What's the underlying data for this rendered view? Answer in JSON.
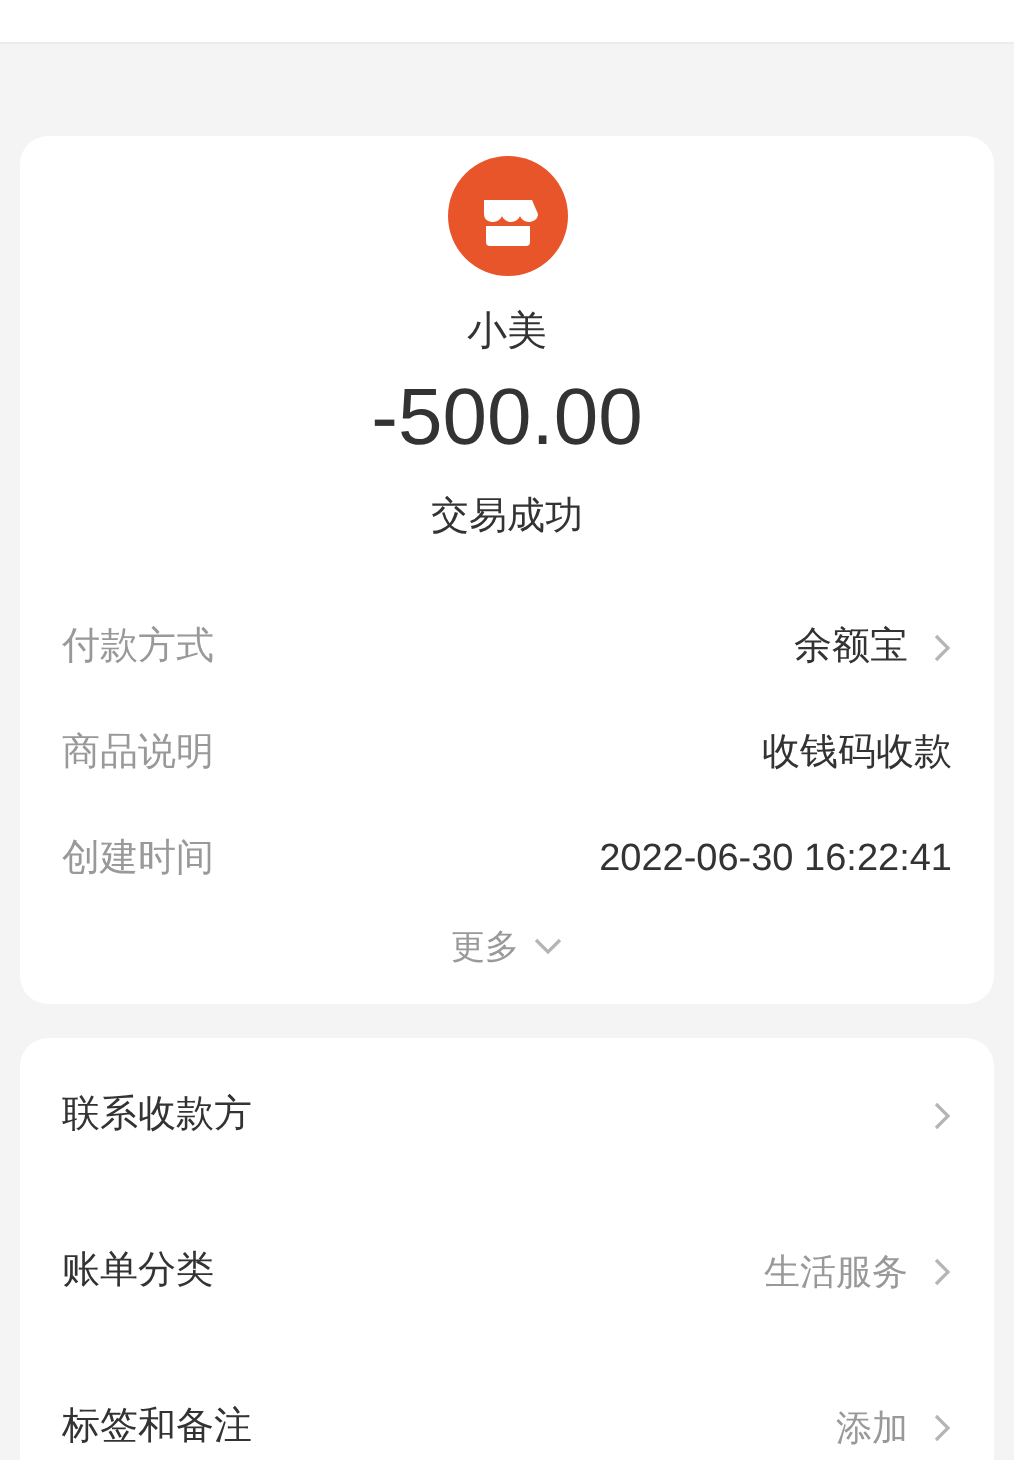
{
  "merchant": {
    "name": "小美"
  },
  "amount": "-500.00",
  "status": "交易成功",
  "details": [
    {
      "label": "付款方式",
      "value": "余额宝",
      "has_arrow": true
    },
    {
      "label": "商品说明",
      "value": "收钱码收款",
      "has_arrow": false
    },
    {
      "label": "创建时间",
      "value": "2022-06-30 16:22:41",
      "has_arrow": false
    }
  ],
  "more": "更多",
  "actions": [
    {
      "label": "联系收款方"
    },
    {
      "label": "账单分类",
      "value": "生活服务"
    },
    {
      "label": "标签和备注",
      "value": "添加"
    }
  ]
}
